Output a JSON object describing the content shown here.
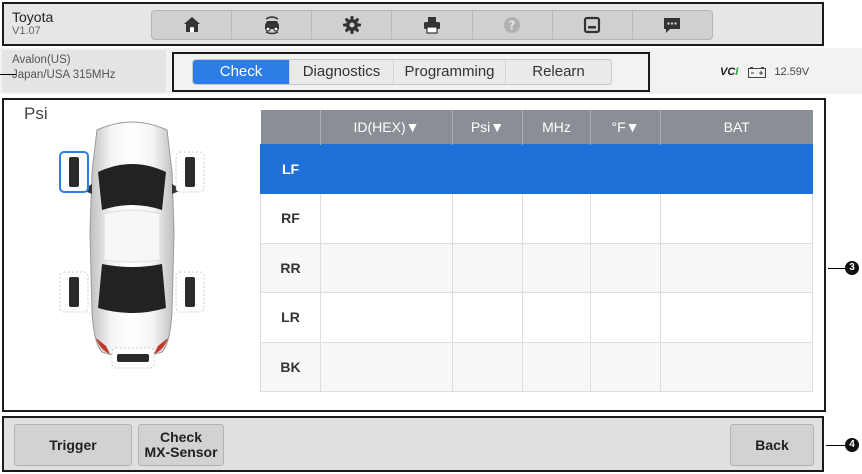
{
  "header": {
    "make": "Toyota",
    "version": "V1.07",
    "toolbar_icons": [
      "home-icon",
      "vehicle-swap-icon",
      "settings-icon",
      "print-icon",
      "help-icon",
      "save-icon",
      "data-logging-icon"
    ]
  },
  "vehicle": {
    "model": "Avalon(US)",
    "region": "Japan/USA 315MHz"
  },
  "tabs": [
    {
      "label": "Check",
      "active": true
    },
    {
      "label": "Diagnostics",
      "active": false
    },
    {
      "label": "Programming",
      "active": false
    },
    {
      "label": "Relearn",
      "active": false
    }
  ],
  "vci": {
    "logo": "VCI",
    "voltage": "12.59V"
  },
  "main": {
    "unit": "Psi",
    "selected_sensor": "LF",
    "table": {
      "columns": [
        "",
        "ID(HEX)▼",
        "Psi▼",
        "MHz",
        "°F▼",
        "BAT"
      ],
      "rows": [
        {
          "pos": "LF",
          "id": "",
          "psi": "",
          "mhz": "",
          "temp": "",
          "bat": ""
        },
        {
          "pos": "RF",
          "id": "",
          "psi": "",
          "mhz": "",
          "temp": "",
          "bat": ""
        },
        {
          "pos": "RR",
          "id": "",
          "psi": "",
          "mhz": "",
          "temp": "",
          "bat": ""
        },
        {
          "pos": "LR",
          "id": "",
          "psi": "",
          "mhz": "",
          "temp": "",
          "bat": ""
        },
        {
          "pos": "BK",
          "id": "",
          "psi": "",
          "mhz": "",
          "temp": "",
          "bat": ""
        }
      ]
    }
  },
  "footer": {
    "trigger": "Trigger",
    "check_mx": "Check\nMX-Sensor",
    "back": "Back"
  },
  "callouts": {
    "main_panel": "3",
    "bottom_bar": "4"
  },
  "colors": {
    "accent": "#2c7ee6",
    "selected_row": "#1f70d9",
    "table_header": "#8a8f96"
  }
}
